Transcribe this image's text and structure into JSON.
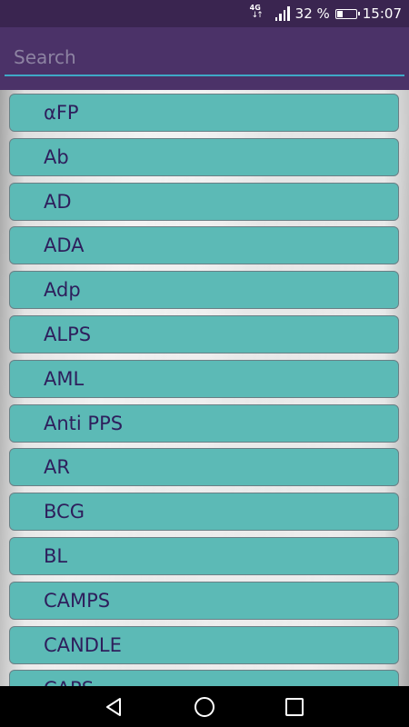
{
  "status_bar": {
    "network": "4G",
    "battery_percent_text": "32 %",
    "battery_level": 0.32,
    "time": "15:07"
  },
  "search": {
    "placeholder": "Search",
    "value": ""
  },
  "list": {
    "items": [
      {
        "label": "αFP"
      },
      {
        "label": "Ab"
      },
      {
        "label": "AD"
      },
      {
        "label": "ADA"
      },
      {
        "label": "Adp"
      },
      {
        "label": "ALPS"
      },
      {
        "label": "AML"
      },
      {
        "label": "Anti PPS"
      },
      {
        "label": "AR"
      },
      {
        "label": "BCG"
      },
      {
        "label": "BL"
      },
      {
        "label": "CAMPS"
      },
      {
        "label": "CANDLE"
      },
      {
        "label": "CAPS"
      }
    ]
  },
  "nav": {
    "back_icon": "back-triangle-icon",
    "home_icon": "home-circle-icon",
    "recents_icon": "recents-square-icon"
  },
  "colors": {
    "status_bar": "#3a2550",
    "header": "#4b3268",
    "search_underline": "#3fa9c7",
    "item_fill": "#5cbab6",
    "item_text": "#2e1e5c"
  }
}
